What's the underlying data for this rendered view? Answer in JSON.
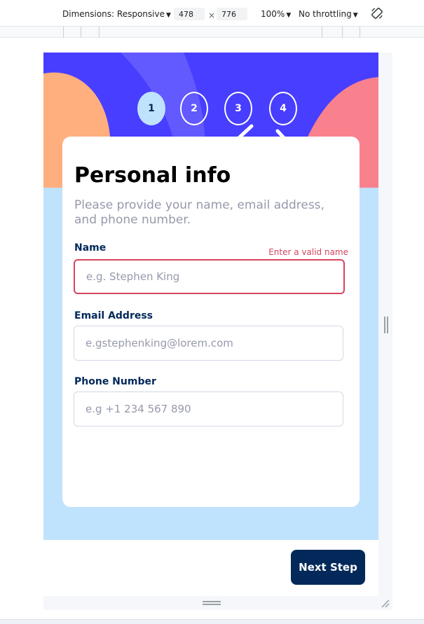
{
  "devtools": {
    "dimensions_label": "Dimensions: Responsive",
    "width_value": "478",
    "times": "×",
    "height_value": "776",
    "zoom": "100%",
    "throttle": "No throttling"
  },
  "steps": [
    "1",
    "2",
    "3",
    "4"
  ],
  "active_step": 1,
  "form": {
    "title": "Personal info",
    "subtitle": "Please provide your name, email address, and phone number.",
    "name": {
      "label": "Name",
      "error": "Enter a valid name",
      "placeholder": "e.g. Stephen King"
    },
    "email": {
      "label": "Email Address",
      "placeholder": "e.gstephenking@lorem.com"
    },
    "phone": {
      "label": "Phone Number",
      "placeholder": "e.g +1 234 567 890"
    }
  },
  "footer": {
    "next_label": "Next Step"
  },
  "colors": {
    "marine_blue": "#02295a",
    "purplish_blue": "#483eff",
    "light_blue": "#bfe2fd",
    "strawberry_red": "#d6445d",
    "cool_gray": "#9699ab",
    "light_gray": "#d6d9e6"
  }
}
